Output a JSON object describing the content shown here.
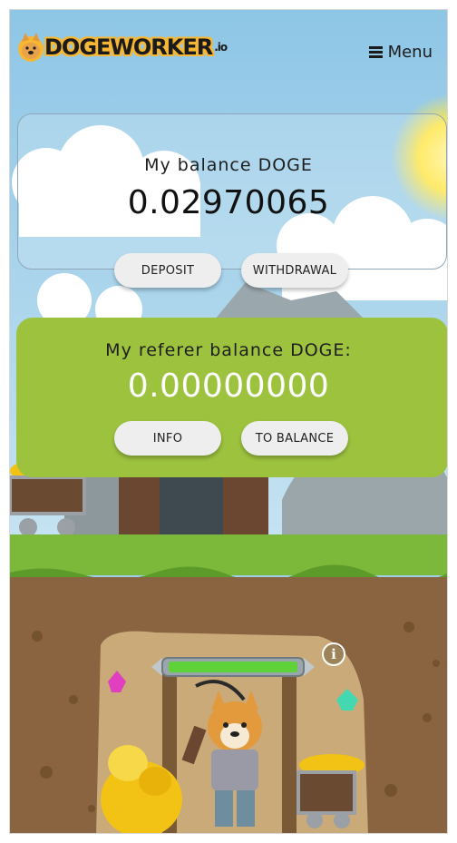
{
  "header": {
    "logo_text": "DOGEWORKER",
    "logo_suffix": ".io",
    "menu_label": "Menu",
    "menu_icon": "hamburger-icon"
  },
  "balance": {
    "title": "My balance DOGE",
    "value": "0.02970065",
    "deposit_label": "DEPOSIT",
    "withdrawal_label": "WITHDRAWAL"
  },
  "referer": {
    "title": "My referer balance DOGE:",
    "value": "0.00000000",
    "info_label": "INFO",
    "to_balance_label": "TO BALANCE"
  },
  "mine": {
    "info_icon": "info-icon",
    "info_glyph": "i",
    "work_progress": 1.0
  },
  "colors": {
    "sky": "#9fd0ea",
    "referer_card": "#9dc23e",
    "grass": "#7cb83a",
    "dirt": "#8a6440",
    "progress": "#5fd23a"
  }
}
